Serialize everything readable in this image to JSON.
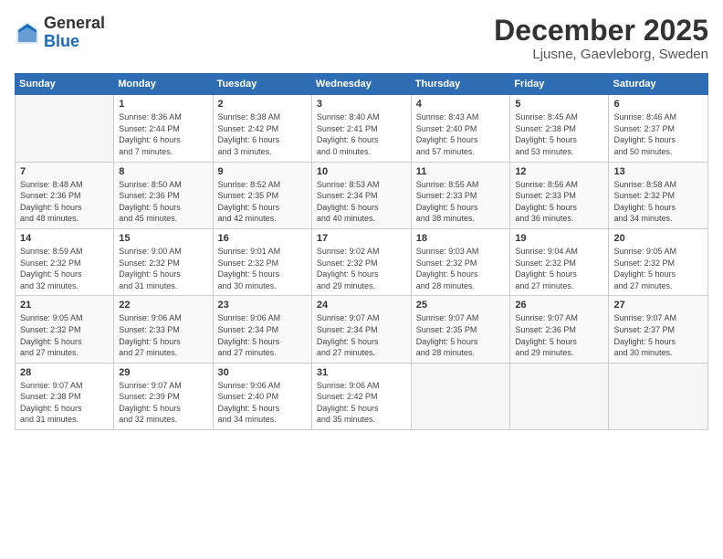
{
  "header": {
    "logo_general": "General",
    "logo_blue": "Blue",
    "month": "December 2025",
    "location": "Ljusne, Gaevleborg, Sweden"
  },
  "days_of_week": [
    "Sunday",
    "Monday",
    "Tuesday",
    "Wednesday",
    "Thursday",
    "Friday",
    "Saturday"
  ],
  "weeks": [
    [
      {
        "day": "",
        "info": ""
      },
      {
        "day": "1",
        "info": "Sunrise: 8:36 AM\nSunset: 2:44 PM\nDaylight: 6 hours\nand 7 minutes."
      },
      {
        "day": "2",
        "info": "Sunrise: 8:38 AM\nSunset: 2:42 PM\nDaylight: 6 hours\nand 3 minutes."
      },
      {
        "day": "3",
        "info": "Sunrise: 8:40 AM\nSunset: 2:41 PM\nDaylight: 6 hours\nand 0 minutes."
      },
      {
        "day": "4",
        "info": "Sunrise: 8:43 AM\nSunset: 2:40 PM\nDaylight: 5 hours\nand 57 minutes."
      },
      {
        "day": "5",
        "info": "Sunrise: 8:45 AM\nSunset: 2:38 PM\nDaylight: 5 hours\nand 53 minutes."
      },
      {
        "day": "6",
        "info": "Sunrise: 8:46 AM\nSunset: 2:37 PM\nDaylight: 5 hours\nand 50 minutes."
      }
    ],
    [
      {
        "day": "7",
        "info": "Sunrise: 8:48 AM\nSunset: 2:36 PM\nDaylight: 5 hours\nand 48 minutes."
      },
      {
        "day": "8",
        "info": "Sunrise: 8:50 AM\nSunset: 2:36 PM\nDaylight: 5 hours\nand 45 minutes."
      },
      {
        "day": "9",
        "info": "Sunrise: 8:52 AM\nSunset: 2:35 PM\nDaylight: 5 hours\nand 42 minutes."
      },
      {
        "day": "10",
        "info": "Sunrise: 8:53 AM\nSunset: 2:34 PM\nDaylight: 5 hours\nand 40 minutes."
      },
      {
        "day": "11",
        "info": "Sunrise: 8:55 AM\nSunset: 2:33 PM\nDaylight: 5 hours\nand 38 minutes."
      },
      {
        "day": "12",
        "info": "Sunrise: 8:56 AM\nSunset: 2:33 PM\nDaylight: 5 hours\nand 36 minutes."
      },
      {
        "day": "13",
        "info": "Sunrise: 8:58 AM\nSunset: 2:32 PM\nDaylight: 5 hours\nand 34 minutes."
      }
    ],
    [
      {
        "day": "14",
        "info": "Sunrise: 8:59 AM\nSunset: 2:32 PM\nDaylight: 5 hours\nand 32 minutes."
      },
      {
        "day": "15",
        "info": "Sunrise: 9:00 AM\nSunset: 2:32 PM\nDaylight: 5 hours\nand 31 minutes."
      },
      {
        "day": "16",
        "info": "Sunrise: 9:01 AM\nSunset: 2:32 PM\nDaylight: 5 hours\nand 30 minutes."
      },
      {
        "day": "17",
        "info": "Sunrise: 9:02 AM\nSunset: 2:32 PM\nDaylight: 5 hours\nand 29 minutes."
      },
      {
        "day": "18",
        "info": "Sunrise: 9:03 AM\nSunset: 2:32 PM\nDaylight: 5 hours\nand 28 minutes."
      },
      {
        "day": "19",
        "info": "Sunrise: 9:04 AM\nSunset: 2:32 PM\nDaylight: 5 hours\nand 27 minutes."
      },
      {
        "day": "20",
        "info": "Sunrise: 9:05 AM\nSunset: 2:32 PM\nDaylight: 5 hours\nand 27 minutes."
      }
    ],
    [
      {
        "day": "21",
        "info": "Sunrise: 9:05 AM\nSunset: 2:32 PM\nDaylight: 5 hours\nand 27 minutes."
      },
      {
        "day": "22",
        "info": "Sunrise: 9:06 AM\nSunset: 2:33 PM\nDaylight: 5 hours\nand 27 minutes."
      },
      {
        "day": "23",
        "info": "Sunrise: 9:06 AM\nSunset: 2:34 PM\nDaylight: 5 hours\nand 27 minutes."
      },
      {
        "day": "24",
        "info": "Sunrise: 9:07 AM\nSunset: 2:34 PM\nDaylight: 5 hours\nand 27 minutes."
      },
      {
        "day": "25",
        "info": "Sunrise: 9:07 AM\nSunset: 2:35 PM\nDaylight: 5 hours\nand 28 minutes."
      },
      {
        "day": "26",
        "info": "Sunrise: 9:07 AM\nSunset: 2:36 PM\nDaylight: 5 hours\nand 29 minutes."
      },
      {
        "day": "27",
        "info": "Sunrise: 9:07 AM\nSunset: 2:37 PM\nDaylight: 5 hours\nand 30 minutes."
      }
    ],
    [
      {
        "day": "28",
        "info": "Sunrise: 9:07 AM\nSunset: 2:38 PM\nDaylight: 5 hours\nand 31 minutes."
      },
      {
        "day": "29",
        "info": "Sunrise: 9:07 AM\nSunset: 2:39 PM\nDaylight: 5 hours\nand 32 minutes."
      },
      {
        "day": "30",
        "info": "Sunrise: 9:06 AM\nSunset: 2:40 PM\nDaylight: 5 hours\nand 34 minutes."
      },
      {
        "day": "31",
        "info": "Sunrise: 9:06 AM\nSunset: 2:42 PM\nDaylight: 5 hours\nand 35 minutes."
      },
      {
        "day": "",
        "info": ""
      },
      {
        "day": "",
        "info": ""
      },
      {
        "day": "",
        "info": ""
      }
    ]
  ]
}
